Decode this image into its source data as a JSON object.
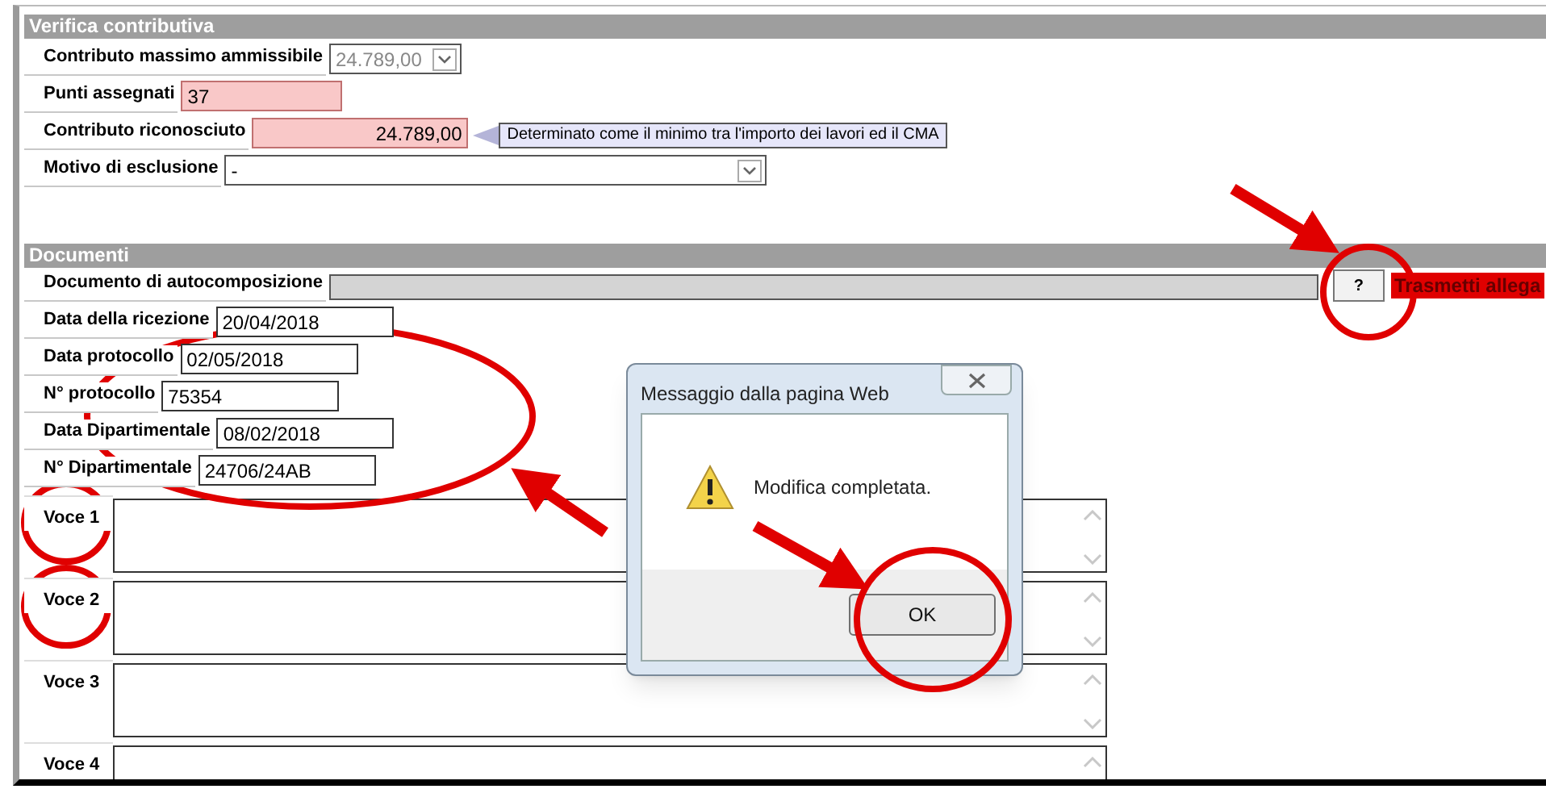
{
  "verifica": {
    "title": "Verifica contributiva",
    "rows": [
      {
        "kind": "select",
        "label": "Contributo massimo ammissibile",
        "value": "24.789,00",
        "disabled": true
      },
      {
        "kind": "input",
        "label": "Punti assegnati",
        "value": "37",
        "highlighted": true
      },
      {
        "kind": "amount",
        "label": "Contributo riconosciuto",
        "value": "24.789,00",
        "highlighted": true,
        "note": "Determinato come il minimo tra l'importo dei lavori ed il CMA"
      },
      {
        "kind": "select",
        "label": "Motivo di esclusione",
        "value": "-",
        "disabled": false
      }
    ]
  },
  "documenti": {
    "title": "Documenti",
    "autocomposizione": {
      "label": "Documento di autocomposizione",
      "help_button": "?",
      "action": "Trasmetti allega"
    },
    "fields": [
      {
        "label": "Data della ricezione",
        "value": "20/04/2018"
      },
      {
        "label": "Data protocollo",
        "value": "02/05/2018"
      },
      {
        "label": "N° protocollo",
        "value": "75354"
      },
      {
        "label": "Data Dipartimentale",
        "value": "08/02/2018"
      },
      {
        "label": "N° Dipartimentale",
        "value": "24706/24AB"
      }
    ],
    "voci": [
      {
        "label": "Voce 1"
      },
      {
        "label": "Voce 2"
      },
      {
        "label": "Voce 3"
      },
      {
        "label": "Voce 4"
      }
    ]
  },
  "dialog": {
    "title": "Messaggio dalla pagina Web",
    "message": "Modifica completata.",
    "button": "OK"
  }
}
